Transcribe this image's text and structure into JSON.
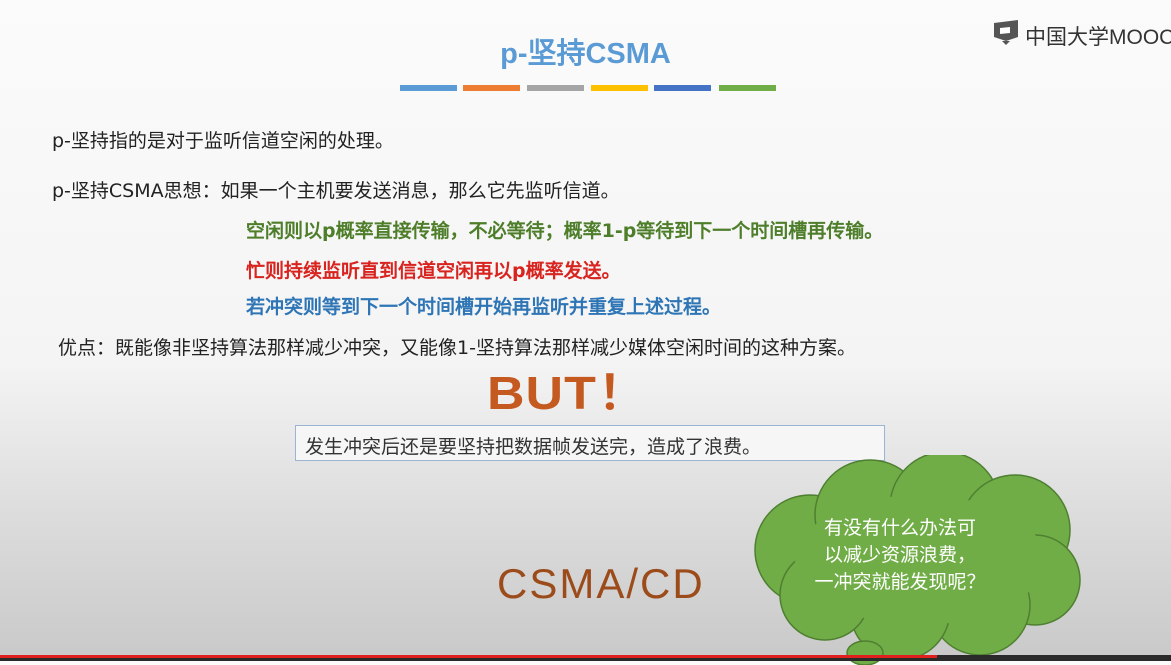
{
  "logo": {
    "text": "中国大学MOOC",
    "icon": "mooc-logo-icon"
  },
  "slide": {
    "title": "p-坚持CSMA",
    "title_bar_colors": [
      "#5b9bd5",
      "#ed7d31",
      "#a5a5a5",
      "#ffc000",
      "#4472c4",
      "#70ad47"
    ],
    "lines": {
      "definition": "p-坚持指的是对于监听信道空闲的处理。",
      "idea": "p-坚持CSMA思想：如果一个主机要发送消息，那么它先监听信道。",
      "idle": "空闲则以p概率直接传输，不必等待；概率1-p等待到下一个时间槽再传输。",
      "busy": "忙则持续监听直到信道空闲再以p概率发送。",
      "collision": "若冲突则等到下一个时间槽开始再监听并重复上述过程。",
      "advantage": "优点：既能像非坚持算法那样减少冲突，又能像1-坚持算法那样减少媒体空闲时间的这种方案。"
    },
    "but": "BUT！",
    "drawback": "发生冲突后还是要坚持把数据帧发送完，造成了浪费。",
    "csmacd": "CSMA/CD",
    "cloud_lines": [
      "有没有什么办法可",
      "以减少资源浪费，",
      "一冲突就能发现呢？"
    ]
  },
  "colors": {
    "title": "#5b9bd5",
    "green": "#4e7e2a",
    "red": "#d8231f",
    "blue": "#2e75b6",
    "but": "#c55a21",
    "cloud": "#70ad47",
    "progress": "#e0201f"
  },
  "video": {
    "progress_fraction": 0.8
  }
}
